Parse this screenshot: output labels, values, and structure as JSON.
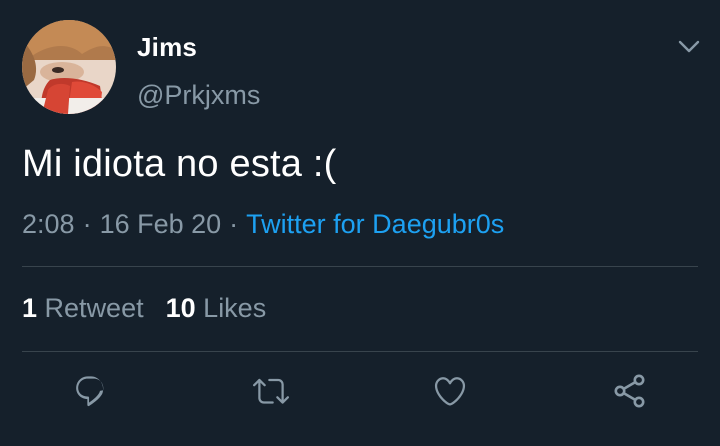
{
  "colors": {
    "background": "#15202b",
    "text_primary": "#ffffff",
    "text_secondary": "#8899a6",
    "link": "#1da1f2",
    "divider": "#38444d"
  },
  "author": {
    "display_name": "Jims",
    "handle": "@Prkjxms",
    "avatar_icon": "profile-photo"
  },
  "tweet": {
    "text": "Mi idiota no esta :("
  },
  "meta": {
    "time": "2:08",
    "separator": "·",
    "date": "16 Feb 20",
    "source": "Twitter for Daegubr0s"
  },
  "stats": {
    "retweets_count": "1",
    "retweets_label": "Retweet",
    "likes_count": "10",
    "likes_label": "Likes"
  },
  "actions": {
    "more_icon": "chevron-down-icon",
    "reply_icon": "reply-icon",
    "retweet_icon": "retweet-icon",
    "like_icon": "heart-icon",
    "share_icon": "share-icon"
  }
}
